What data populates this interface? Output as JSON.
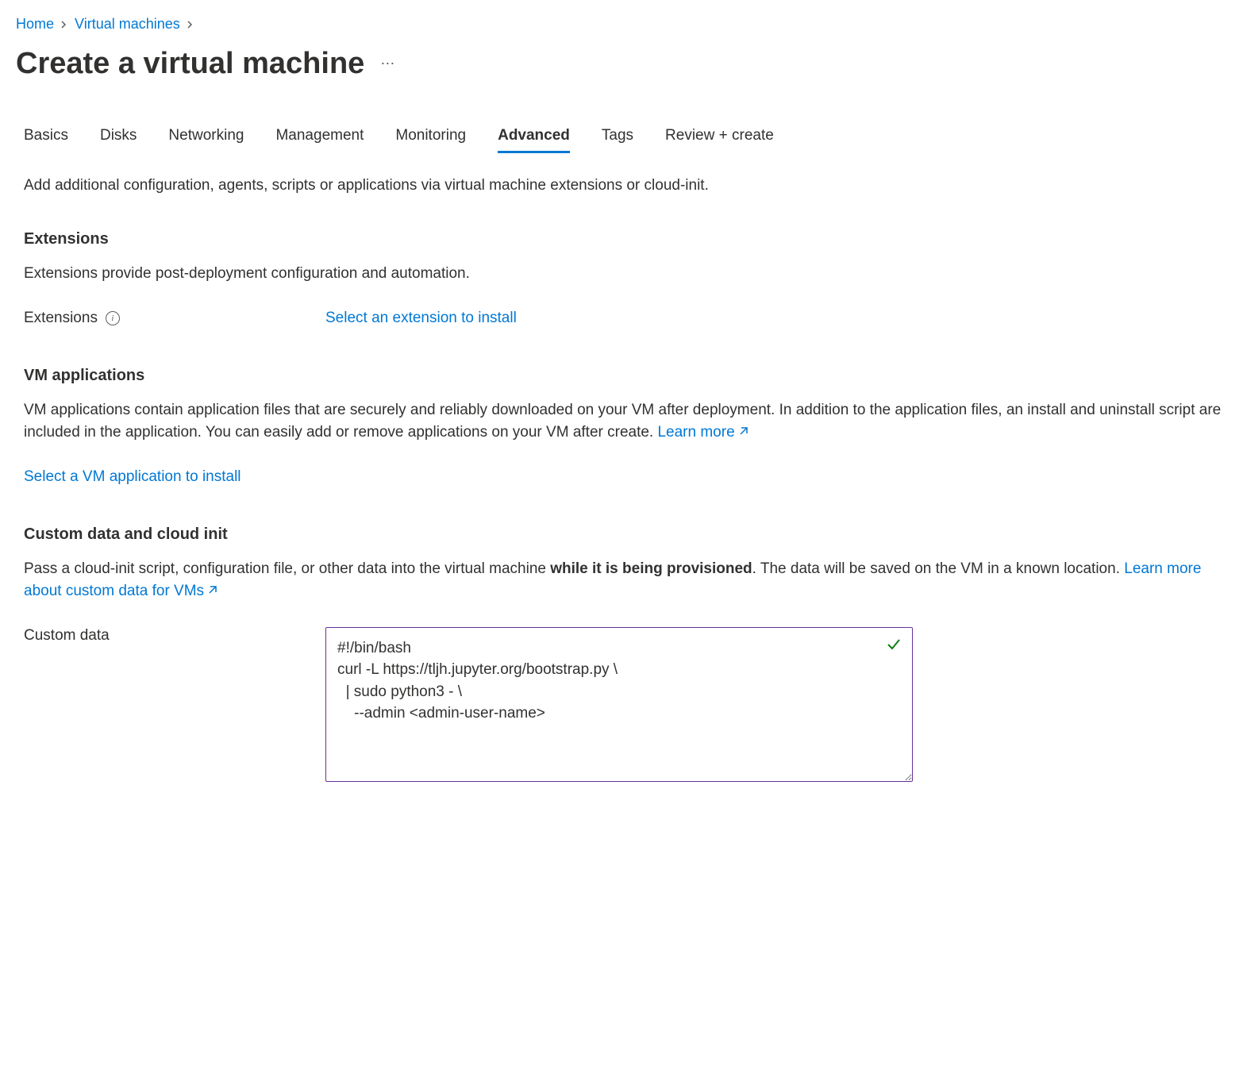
{
  "breadcrumb": {
    "home": "Home",
    "vms": "Virtual machines"
  },
  "page_title": "Create a virtual machine",
  "tabs": [
    {
      "label": "Basics"
    },
    {
      "label": "Disks"
    },
    {
      "label": "Networking"
    },
    {
      "label": "Management"
    },
    {
      "label": "Monitoring"
    },
    {
      "label": "Advanced"
    },
    {
      "label": "Tags"
    },
    {
      "label": "Review + create"
    }
  ],
  "intro": "Add additional configuration, agents, scripts or applications via virtual machine extensions or cloud-init.",
  "extensions": {
    "title": "Extensions",
    "desc": "Extensions provide post-deployment configuration and automation.",
    "label": "Extensions",
    "select_link": "Select an extension to install"
  },
  "vm_apps": {
    "title": "VM applications",
    "desc": "VM applications contain application files that are securely and reliably downloaded on your VM after deployment. In addition to the application files, an install and uninstall script are included in the application. You can easily add or remove applications on your VM after create. ",
    "learn_more": "Learn more",
    "select_link": "Select a VM application to install"
  },
  "custom_data": {
    "title": "Custom data and cloud init",
    "desc_pre": "Pass a cloud-init script, configuration file, or other data into the virtual machine ",
    "desc_bold": "while it is being provisioned",
    "desc_post": ". The data will be saved on the VM in a known location. ",
    "learn_more": "Learn more about custom data for VMs",
    "label": "Custom data",
    "value": "#!/bin/bash\ncurl -L https://tljh.jupyter.org/bootstrap.py \\\n  | sudo python3 - \\\n    --admin <admin-user-name>"
  }
}
